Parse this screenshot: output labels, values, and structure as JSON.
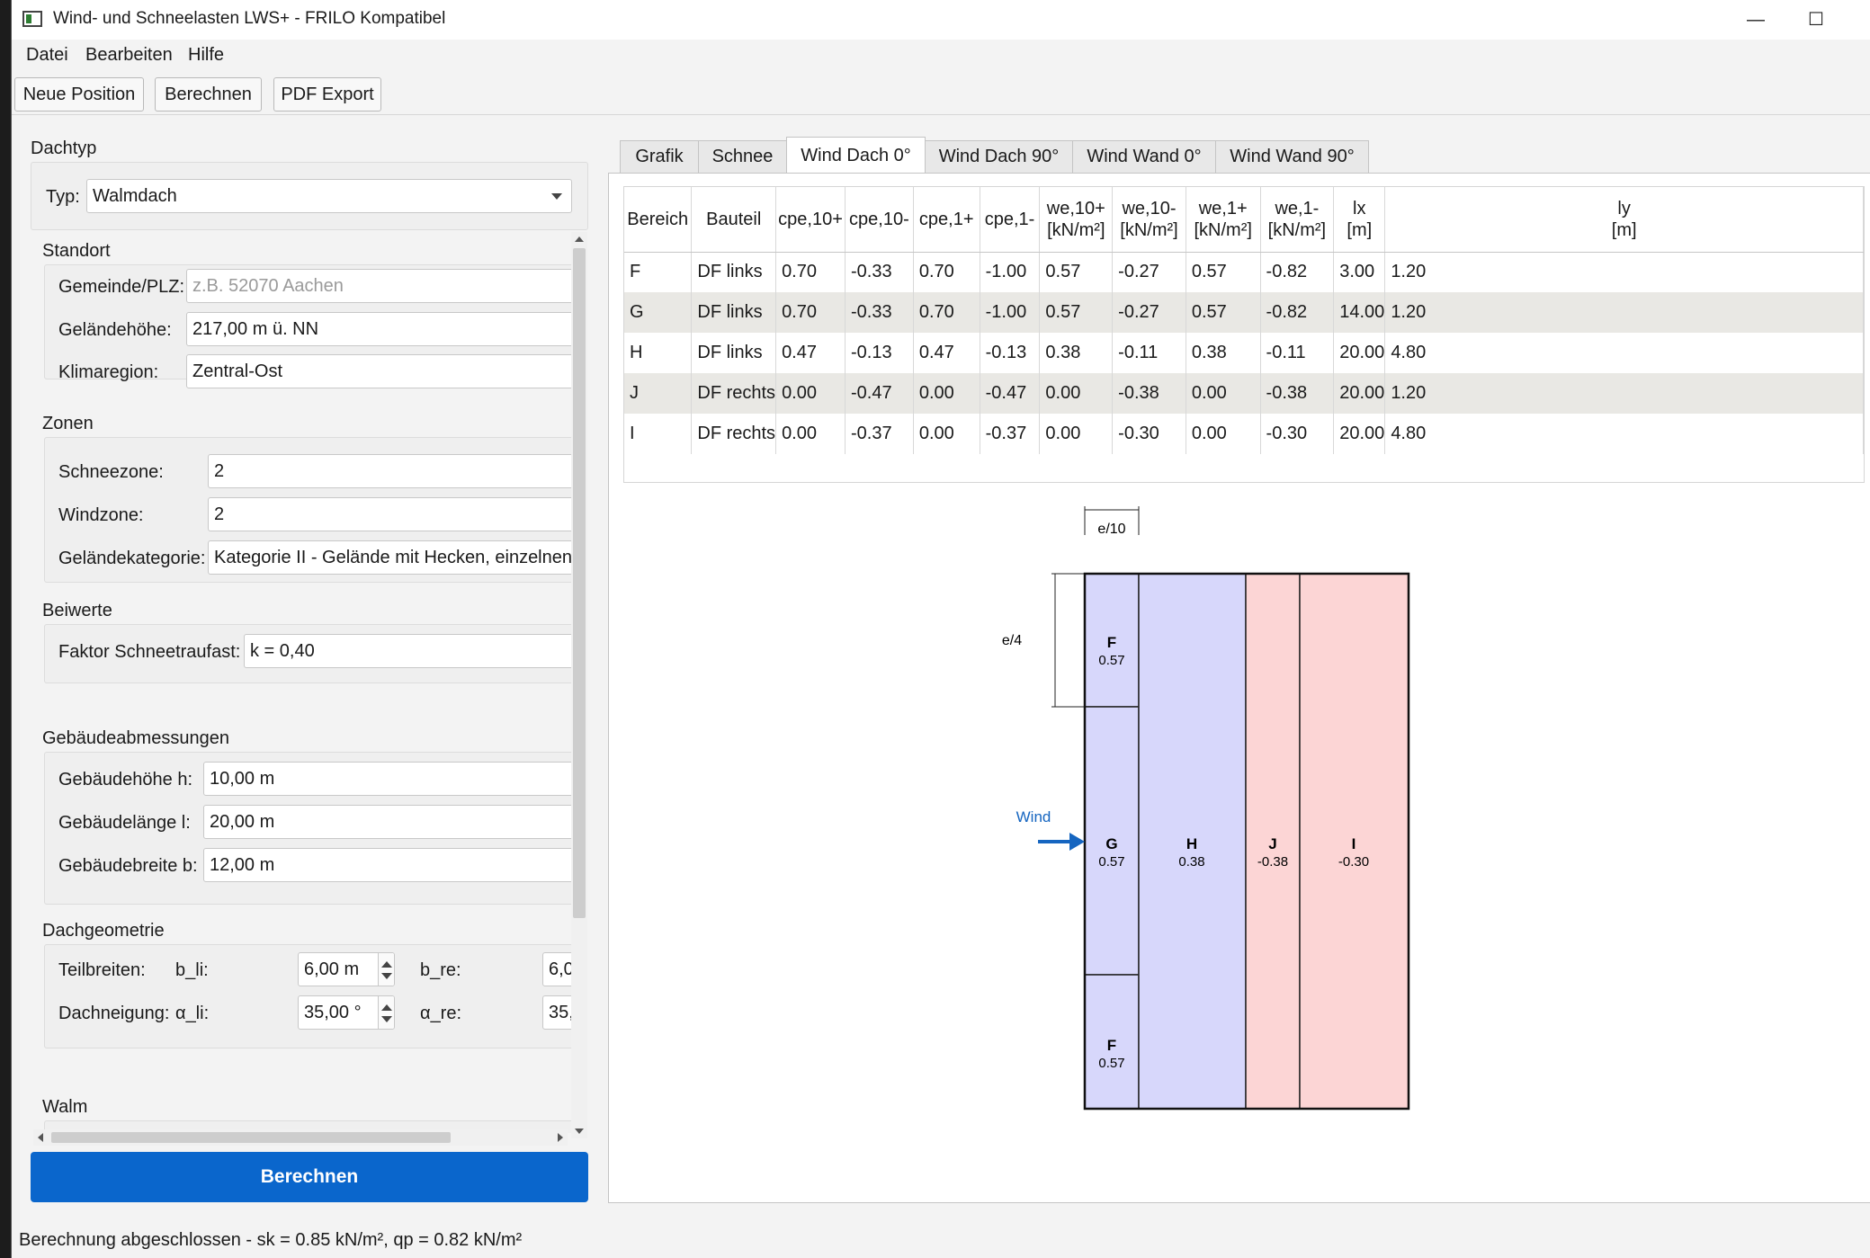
{
  "window": {
    "title": "Wind- und Schneelasten LWS+ - FRILO Kompatibel",
    "min": "—",
    "max": "☐",
    "close": "✕"
  },
  "menu": [
    "Datei",
    "Bearbeiten",
    "Hilfe"
  ],
  "toolbar": [
    "Neue Position",
    "Berechnen",
    "PDF Export"
  ],
  "dachtyp": {
    "title": "Dachtyp",
    "typ_label": "Typ:",
    "typ_value": "Walmdach"
  },
  "standort": {
    "title": "Standort",
    "gemeinde_label": "Gemeinde/PLZ:",
    "gemeinde_placeholder": "z.B. 52070 Aachen",
    "hoehe_label": "Geländehöhe:",
    "hoehe_value": "217,00 m ü. NN",
    "klima_label": "Klimaregion:",
    "klima_value": "Zentral-Ost"
  },
  "zonen": {
    "title": "Zonen",
    "schnee_label": "Schneezone:",
    "schnee_value": "2",
    "wind_label": "Windzone:",
    "wind_value": "2",
    "kat_label": "Geländekategorie:",
    "kat_value": "Kategorie II - Gelände mit Hecken, einzelnen H"
  },
  "beiwerte": {
    "title": "Beiwerte",
    "faktor_label": "Faktor Schneetraufast:",
    "faktor_value": "k = 0,40"
  },
  "gebaeude": {
    "title": "Gebäudeabmessungen",
    "h_label": "Gebäudehöhe h:",
    "h_value": "10,00 m",
    "l_label": "Gebäudelänge l:",
    "l_value": "20,00 m",
    "b_label": "Gebäudebreite b:",
    "b_value": "12,00 m"
  },
  "dachgeo": {
    "title": "Dachgeometrie",
    "teil_label": "Teilbreiten:",
    "bli_label": "b_li:",
    "bli_value": "6,00 m",
    "bre_label": "b_re:",
    "bre_value": "6,0",
    "neig_label": "Dachneigung:",
    "ali_label": "α_li:",
    "ali_value": "35,00 °",
    "are_label": "α_re:",
    "are_value": "35,"
  },
  "walm": {
    "title": "Walm"
  },
  "calc_button": "Berechnen",
  "status": "Berechnung abgeschlossen - sk = 0.85 kN/m², qp = 0.82 kN/m²",
  "tabs": [
    "Grafik",
    "Schnee",
    "Wind Dach 0°",
    "Wind Dach 90°",
    "Wind Wand 0°",
    "Wind Wand 90°"
  ],
  "table": {
    "headers": [
      [
        "Bereich",
        ""
      ],
      [
        "Bauteil",
        ""
      ],
      [
        "cpe,10+",
        ""
      ],
      [
        "cpe,10-",
        ""
      ],
      [
        "cpe,1+",
        ""
      ],
      [
        "cpe,1-",
        ""
      ],
      [
        "we,10+",
        "[kN/m²]"
      ],
      [
        "we,10-",
        "[kN/m²]"
      ],
      [
        "we,1+",
        "[kN/m²]"
      ],
      [
        "we,1-",
        "[kN/m²]"
      ],
      [
        "lx",
        "[m]"
      ],
      [
        "ly",
        "[m]"
      ]
    ],
    "rows": [
      [
        "F",
        "DF links",
        "0.70",
        "-0.33",
        "0.70",
        "-1.00",
        "0.57",
        "-0.27",
        "0.57",
        "-0.82",
        "3.00",
        "1.20"
      ],
      [
        "G",
        "DF links",
        "0.70",
        "-0.33",
        "0.70",
        "-1.00",
        "0.57",
        "-0.27",
        "0.57",
        "-0.82",
        "14.00",
        "1.20"
      ],
      [
        "H",
        "DF links",
        "0.47",
        "-0.13",
        "0.47",
        "-0.13",
        "0.38",
        "-0.11",
        "0.38",
        "-0.11",
        "20.00",
        "4.80"
      ],
      [
        "J",
        "DF rechts",
        "0.00",
        "-0.47",
        "0.00",
        "-0.47",
        "0.00",
        "-0.38",
        "0.00",
        "-0.38",
        "20.00",
        "1.20"
      ],
      [
        "I",
        "DF rechts",
        "0.00",
        "-0.37",
        "0.00",
        "-0.37",
        "0.00",
        "-0.30",
        "0.00",
        "-0.30",
        "20.00",
        "4.80"
      ]
    ]
  },
  "diagram": {
    "dim_top": "e/10",
    "dim_left": "e/4",
    "wind_label": "Wind",
    "zones": [
      {
        "name": "F",
        "value": "0.57"
      },
      {
        "name": "G",
        "value": "0.57"
      },
      {
        "name": "F",
        "value": "0.57"
      },
      {
        "name": "H",
        "value": "0.38"
      },
      {
        "name": "J",
        "value": "-0.38"
      },
      {
        "name": "I",
        "value": "-0.30"
      }
    ],
    "colors": {
      "pressure": "#d7d7fb",
      "suction": "#fcd5d5",
      "wind": "#1565c0"
    }
  }
}
